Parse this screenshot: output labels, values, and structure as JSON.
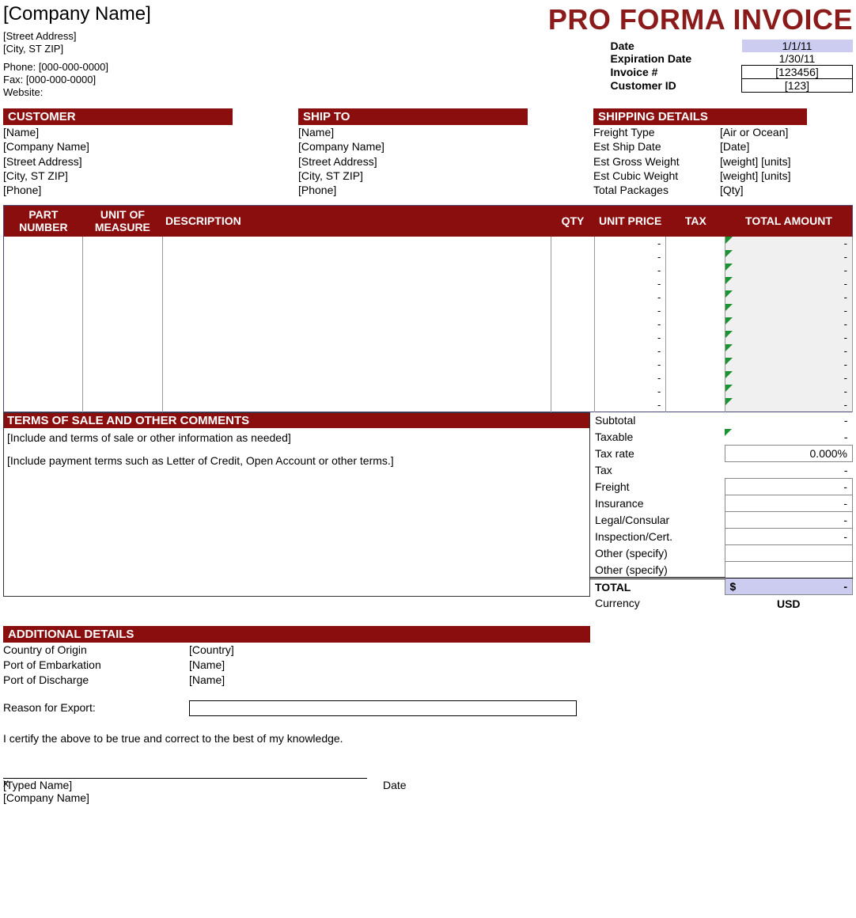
{
  "header": {
    "company_name": "[Company Name]",
    "doc_title": "PRO FORMA INVOICE",
    "street": "[Street Address]",
    "city": "[City, ST  ZIP]",
    "phone_label": "Phone: [000-000-0000]",
    "fax_label": "Fax: [000-000-0000]",
    "website_label": "Website:"
  },
  "meta": {
    "date_label": "Date",
    "date_val": "1/1/11",
    "exp_label": "Expiration Date",
    "exp_val": "1/30/11",
    "inv_label": "Invoice #",
    "inv_val": "[123456]",
    "cust_label": "Customer ID",
    "cust_val": "[123]"
  },
  "customer": {
    "hdr": "CUSTOMER",
    "name": "[Name]",
    "company": "[Company Name]",
    "street": "[Street Address]",
    "city": "[City, ST  ZIP]",
    "phone": "[Phone]"
  },
  "shipto": {
    "hdr": "SHIP TO",
    "name": "[Name]",
    "company": "[Company Name]",
    "street": "[Street Address]",
    "city": "[City, ST  ZIP]",
    "phone": "[Phone]"
  },
  "shipping": {
    "hdr": "SHIPPING DETAILS",
    "freight_k": "Freight Type",
    "freight_v": "[Air or Ocean]",
    "date_k": "Est Ship Date",
    "date_v": "[Date]",
    "gw_k": "Est Gross Weight",
    "gw_v": "[weight] [units]",
    "cw_k": "Est Cubic Weight",
    "cw_v": "[weight] [units]",
    "pkg_k": "Total Packages",
    "pkg_v": "[Qty]"
  },
  "cols": {
    "part": "PART NUMBER",
    "uom": "UNIT OF MEASURE",
    "desc": "DESCRIPTION",
    "qty": "QTY",
    "price": "UNIT PRICE",
    "tax": "TAX",
    "total": "TOTAL AMOUNT"
  },
  "item_dash": "-",
  "terms": {
    "hdr": "TERMS OF SALE AND OTHER COMMENTS",
    "l1": "[Include and terms of sale or other information as needed]",
    "l2": "[Include payment terms such as Letter of Credit, Open Account or other terms.]"
  },
  "summary": {
    "subtotal_k": "Subtotal",
    "subtotal_v": "-",
    "taxable_k": "Taxable",
    "taxable_v": "-",
    "taxrate_k": "Tax rate",
    "taxrate_v": "0.000%",
    "tax_k": "Tax",
    "tax_v": "-",
    "freight_k": "Freight",
    "freight_v": "-",
    "ins_k": "Insurance",
    "ins_v": "-",
    "legal_k": "Legal/Consular",
    "legal_v": "-",
    "insp_k": "Inspection/Cert.",
    "insp_v": "-",
    "other1_k": "Other (specify)",
    "other2_k": "Other (specify)",
    "total_k": "TOTAL",
    "total_sym": "$",
    "total_v": "-",
    "curr_k": "Currency",
    "curr_v": "USD"
  },
  "details": {
    "hdr": "ADDITIONAL DETAILS",
    "origin_k": "Country of Origin",
    "origin_v": "[Country]",
    "embark_k": "Port of Embarkation",
    "embark_v": "[Name]",
    "disch_k": "Port of Discharge",
    "disch_v": "[Name]",
    "reason_k": "Reason for Export:",
    "certify": "I certify the above to be true and correct to the best of my knowledge.",
    "x": "x",
    "typed": "[Typed Name]",
    "date": "Date",
    "company": "[Company Name]"
  }
}
